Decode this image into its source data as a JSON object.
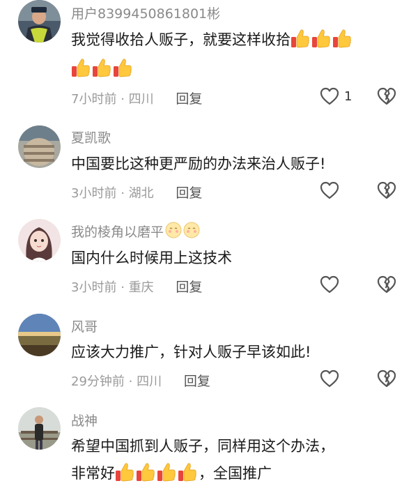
{
  "comments": [
    {
      "username": "用户8399450861801彬",
      "text_line1": "我觉得收拾人贩子，就要这样收拾",
      "text_line2": "",
      "time": "7小时前",
      "location": "四川",
      "reply_label": "回复",
      "like_count": "1",
      "avatar": "police-officer-avatar",
      "emoji_line1": [
        "thumbs-up",
        "thumbs-up",
        "thumbs-up"
      ],
      "emoji_line2": [
        "thumbs-up",
        "thumbs-up",
        "thumbs-up"
      ]
    },
    {
      "username": "夏凯歌",
      "text_line1": "中国要比这种更严励的办法来治人贩子!",
      "time": "3小时前",
      "location": "湖北",
      "reply_label": "回复",
      "like_count": "",
      "avatar": "landscape-avatar"
    },
    {
      "username": "我的棱角以磨平",
      "text_line1": "国内什么时候用上这技术",
      "time": "3小时前",
      "location": "重庆",
      "reply_label": "回复",
      "like_count": "",
      "avatar": "girl-avatar",
      "username_emoji": [
        "blush-face",
        "blush-face"
      ]
    },
    {
      "username": "风哥",
      "text_line1": "应该大力推广，针对人贩子早该如此!",
      "time": "29分钟前",
      "location": "四川",
      "reply_label": "回复",
      "like_count": "",
      "avatar": "sunset-landscape-avatar"
    },
    {
      "username": "战神",
      "text_line1": "希望中国抓到人贩子，同样用这个办法，",
      "text_line2_pre": "非常好",
      "text_line2_post": "，全国推广",
      "avatar": "man-outdoor-avatar",
      "emoji_line2": [
        "thumbs-up",
        "thumbs-up",
        "thumbs-up",
        "thumbs-up"
      ]
    }
  ],
  "meta_separator": "·",
  "colors": {
    "text": "#1a1a1a",
    "meta": "#9a9a9a",
    "username": "#8a8a8a"
  }
}
